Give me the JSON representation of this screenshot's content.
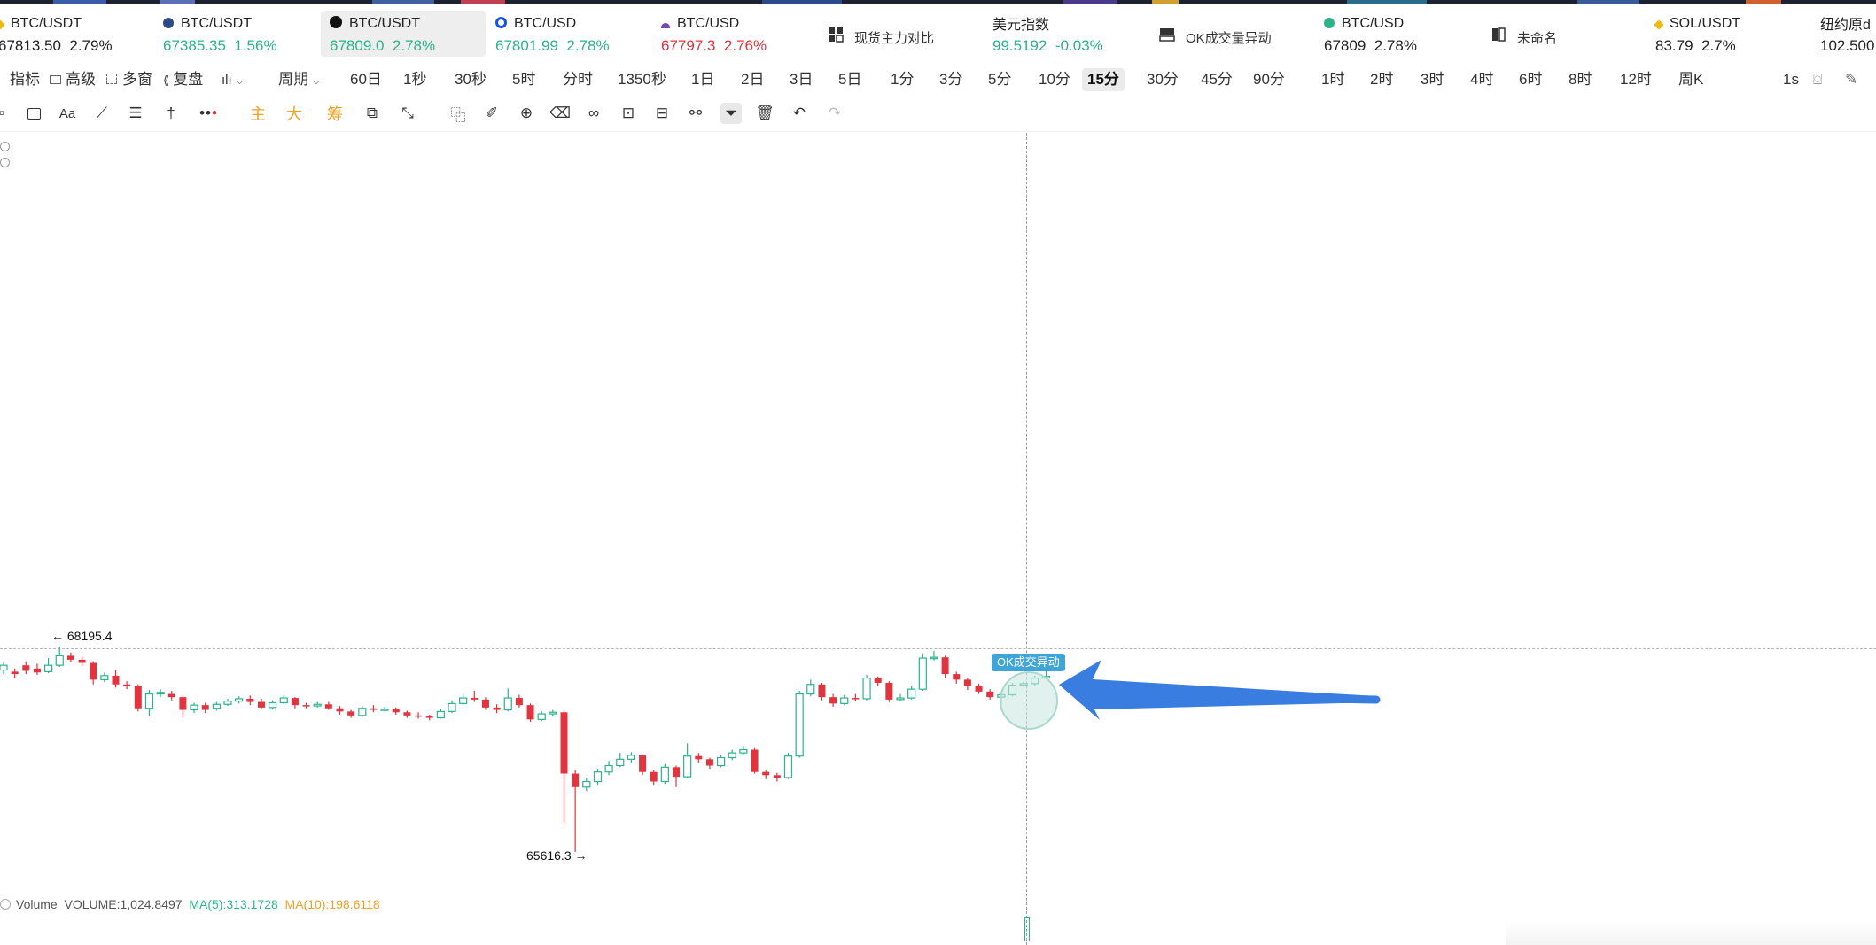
{
  "tickers": [
    {
      "pair": "BTC/USDT",
      "price": "67813.50",
      "change": "2.79%",
      "color": "dark",
      "icon": "binance-icon",
      "icon_color": "#f0b90b",
      "active": false
    },
    {
      "pair": "BTC/USDT",
      "price": "67385.35",
      "change": "1.56%",
      "color": "green",
      "icon": "huobi-icon",
      "icon_color": "#2e4a8a",
      "active": false
    },
    {
      "pair": "BTC/USDT",
      "price": "67809.0",
      "change": "2.78%",
      "color": "green",
      "icon": "okx-icon",
      "icon_color": "#111111",
      "active": true
    },
    {
      "pair": "BTC/USD",
      "price": "67801.99",
      "change": "2.78%",
      "color": "green",
      "icon": "coinbase-icon",
      "icon_color": "#1652f0",
      "active": false
    },
    {
      "pair": "BTC/USD",
      "price": "67797.3",
      "change": "2.76%",
      "color": "red",
      "icon": "kraken-icon",
      "icon_color": "#6f4ab3",
      "active": false
    },
    {
      "label": "现货主力对比",
      "icon": "grid-icon",
      "module": true
    },
    {
      "pair": "美元指数",
      "price": "99.5192",
      "change": "-0.03%",
      "color": "green",
      "icon": "",
      "active": false
    },
    {
      "label": "OK成交量异动",
      "icon": "monitor-icon",
      "module": true
    },
    {
      "pair": "BTC/USD",
      "price": "67809",
      "change": "2.78%",
      "color": "dark",
      "icon": "bitmex-icon",
      "icon_color": "#2bb389",
      "active": false
    },
    {
      "label": "未命名",
      "icon": "split-icon",
      "module": true
    },
    {
      "pair": "SOL/USDT",
      "price": "83.79",
      "change": "2.7%",
      "color": "dark",
      "icon": "binance-icon",
      "icon_color": "#f0b90b",
      "active": false
    },
    {
      "pair": "纽约原d",
      "price": "102.500",
      "change": "",
      "color": "dark",
      "icon": "",
      "active": false
    }
  ],
  "toolbar": {
    "indicator": "指标",
    "advanced": "高级",
    "multi_window": "多窗",
    "replay": "复盘",
    "period": "周期",
    "periods": [
      "60日",
      "1秒",
      "30秒",
      "5时",
      "分时",
      "1350秒",
      "1日",
      "2日",
      "3日",
      "5日",
      "1分",
      "3分",
      "5分",
      "10分",
      "15分",
      "30分",
      "45分",
      "90分",
      "1时",
      "2时",
      "3时",
      "4时",
      "6时",
      "8时",
      "12时",
      "周K"
    ],
    "active_period": "15分",
    "right_interval": "1s"
  },
  "drawing_tools": {
    "text_tool": "Aa",
    "main": "主",
    "big": "大",
    "chips": "筹"
  },
  "chart": {
    "high_label": "← 68195.4",
    "low_label": "65616.3 →",
    "alert_tag": "OK成交异动",
    "colors": {
      "up": "#2bb389",
      "down": "#e0343f",
      "arrow": "#3a7de0"
    }
  },
  "chart_data": {
    "type": "candlestick",
    "title": "BTC/USDT",
    "interval": "15分",
    "high": 68195.4,
    "low": 65616.3,
    "candles": [
      {
        "o": 67900,
        "c": 67960,
        "h": 68000,
        "l": 67850
      },
      {
        "o": 67880,
        "c": 67850,
        "h": 67920,
        "l": 67800
      },
      {
        "o": 67960,
        "c": 67890,
        "h": 68010,
        "l": 67850
      },
      {
        "o": 67920,
        "c": 67870,
        "h": 67980,
        "l": 67840
      },
      {
        "o": 67880,
        "c": 67960,
        "h": 68050,
        "l": 67860
      },
      {
        "o": 67960,
        "c": 68080,
        "h": 68195.4,
        "l": 67940
      },
      {
        "o": 68080,
        "c": 68030,
        "h": 68120,
        "l": 68000
      },
      {
        "o": 68030,
        "c": 67990,
        "h": 68070,
        "l": 67950
      },
      {
        "o": 67990,
        "c": 67780,
        "h": 68010,
        "l": 67720
      },
      {
        "o": 67780,
        "c": 67830,
        "h": 67870,
        "l": 67750
      },
      {
        "o": 67830,
        "c": 67720,
        "h": 67900,
        "l": 67680
      },
      {
        "o": 67720,
        "c": 67700,
        "h": 67760,
        "l": 67660
      },
      {
        "o": 67700,
        "c": 67420,
        "h": 67720,
        "l": 67380
      },
      {
        "o": 67420,
        "c": 67600,
        "h": 67650,
        "l": 67320
      },
      {
        "o": 67600,
        "c": 67620,
        "h": 67660,
        "l": 67560
      },
      {
        "o": 67600,
        "c": 67560,
        "h": 67640,
        "l": 67520
      },
      {
        "o": 67560,
        "c": 67400,
        "h": 67580,
        "l": 67300
      },
      {
        "o": 67400,
        "c": 67460,
        "h": 67490,
        "l": 67360
      },
      {
        "o": 67460,
        "c": 67400,
        "h": 67490,
        "l": 67360
      },
      {
        "o": 67420,
        "c": 67470,
        "h": 67500,
        "l": 67390
      },
      {
        "o": 67470,
        "c": 67510,
        "h": 67540,
        "l": 67450
      },
      {
        "o": 67510,
        "c": 67540,
        "h": 67570,
        "l": 67480
      },
      {
        "o": 67540,
        "c": 67500,
        "h": 67580,
        "l": 67460
      },
      {
        "o": 67500,
        "c": 67430,
        "h": 67540,
        "l": 67410
      },
      {
        "o": 67430,
        "c": 67490,
        "h": 67520,
        "l": 67410
      },
      {
        "o": 67490,
        "c": 67550,
        "h": 67580,
        "l": 67470
      },
      {
        "o": 67550,
        "c": 67460,
        "h": 67560,
        "l": 67420
      },
      {
        "o": 67460,
        "c": 67450,
        "h": 67490,
        "l": 67420
      },
      {
        "o": 67450,
        "c": 67470,
        "h": 67500,
        "l": 67430
      },
      {
        "o": 67470,
        "c": 67420,
        "h": 67500,
        "l": 67400
      },
      {
        "o": 67420,
        "c": 67380,
        "h": 67450,
        "l": 67340
      },
      {
        "o": 67380,
        "c": 67330,
        "h": 67400,
        "l": 67300
      },
      {
        "o": 67330,
        "c": 67420,
        "h": 67450,
        "l": 67310
      },
      {
        "o": 67420,
        "c": 67400,
        "h": 67460,
        "l": 67370
      },
      {
        "o": 67400,
        "c": 67410,
        "h": 67440,
        "l": 67380
      },
      {
        "o": 67410,
        "c": 67370,
        "h": 67430,
        "l": 67340
      },
      {
        "o": 67370,
        "c": 67330,
        "h": 67390,
        "l": 67300
      },
      {
        "o": 67330,
        "c": 67320,
        "h": 67370,
        "l": 67290
      },
      {
        "o": 67320,
        "c": 67300,
        "h": 67340,
        "l": 67270
      },
      {
        "o": 67300,
        "c": 67380,
        "h": 67410,
        "l": 67290
      },
      {
        "o": 67380,
        "c": 67480,
        "h": 67520,
        "l": 67360
      },
      {
        "o": 67480,
        "c": 67550,
        "h": 67600,
        "l": 67460
      },
      {
        "o": 67550,
        "c": 67530,
        "h": 67640,
        "l": 67500
      },
      {
        "o": 67530,
        "c": 67430,
        "h": 67560,
        "l": 67400
      },
      {
        "o": 67430,
        "c": 67400,
        "h": 67470,
        "l": 67360
      },
      {
        "o": 67400,
        "c": 67550,
        "h": 67670,
        "l": 67380
      },
      {
        "o": 67550,
        "c": 67460,
        "h": 67590,
        "l": 67430
      },
      {
        "o": 67460,
        "c": 67280,
        "h": 67480,
        "l": 67250
      },
      {
        "o": 67280,
        "c": 67350,
        "h": 67380,
        "l": 67260
      },
      {
        "o": 67350,
        "c": 67370,
        "h": 67400,
        "l": 67320
      },
      {
        "o": 67370,
        "c": 66600,
        "h": 67390,
        "l": 65980
      },
      {
        "o": 66600,
        "c": 66430,
        "h": 66650,
        "l": 65616.3
      },
      {
        "o": 66430,
        "c": 66500,
        "h": 66550,
        "l": 66380
      },
      {
        "o": 66500,
        "c": 66620,
        "h": 66660,
        "l": 66460
      },
      {
        "o": 66620,
        "c": 66700,
        "h": 66760,
        "l": 66580
      },
      {
        "o": 66700,
        "c": 66780,
        "h": 66860,
        "l": 66680
      },
      {
        "o": 66780,
        "c": 66830,
        "h": 66870,
        "l": 66740
      },
      {
        "o": 66830,
        "c": 66620,
        "h": 66840,
        "l": 66580
      },
      {
        "o": 66620,
        "c": 66500,
        "h": 66650,
        "l": 66460
      },
      {
        "o": 66500,
        "c": 66680,
        "h": 66720,
        "l": 66470
      },
      {
        "o": 66680,
        "c": 66560,
        "h": 66700,
        "l": 66430
      },
      {
        "o": 66560,
        "c": 66820,
        "h": 66980,
        "l": 66540
      },
      {
        "o": 66820,
        "c": 66780,
        "h": 66860,
        "l": 66740
      },
      {
        "o": 66780,
        "c": 66700,
        "h": 66800,
        "l": 66660
      },
      {
        "o": 66700,
        "c": 66800,
        "h": 66830,
        "l": 66680
      },
      {
        "o": 66800,
        "c": 66860,
        "h": 66900,
        "l": 66770
      },
      {
        "o": 66860,
        "c": 66900,
        "h": 66950,
        "l": 66840
      },
      {
        "o": 66900,
        "c": 66620,
        "h": 66920,
        "l": 66600
      },
      {
        "o": 66620,
        "c": 66580,
        "h": 66650,
        "l": 66530
      },
      {
        "o": 66580,
        "c": 66550,
        "h": 66610,
        "l": 66500
      },
      {
        "o": 66550,
        "c": 66820,
        "h": 66860,
        "l": 66530
      },
      {
        "o": 66820,
        "c": 67600,
        "h": 67640,
        "l": 66800
      },
      {
        "o": 67600,
        "c": 67720,
        "h": 67780,
        "l": 67570
      },
      {
        "o": 67720,
        "c": 67560,
        "h": 67740,
        "l": 67520
      },
      {
        "o": 67560,
        "c": 67480,
        "h": 67600,
        "l": 67440
      },
      {
        "o": 67480,
        "c": 67550,
        "h": 67590,
        "l": 67460
      },
      {
        "o": 67550,
        "c": 67540,
        "h": 67600,
        "l": 67510
      },
      {
        "o": 67540,
        "c": 67800,
        "h": 67840,
        "l": 67520
      },
      {
        "o": 67800,
        "c": 67740,
        "h": 67820,
        "l": 67700
      },
      {
        "o": 67740,
        "c": 67530,
        "h": 67760,
        "l": 67500
      },
      {
        "o": 67530,
        "c": 67550,
        "h": 67600,
        "l": 67510
      },
      {
        "o": 67550,
        "c": 67660,
        "h": 67700,
        "l": 67530
      },
      {
        "o": 67660,
        "c": 68050,
        "h": 68110,
        "l": 67640
      },
      {
        "o": 68050,
        "c": 68060,
        "h": 68140,
        "l": 68020
      },
      {
        "o": 68060,
        "c": 67850,
        "h": 68080,
        "l": 67800
      },
      {
        "o": 67850,
        "c": 67780,
        "h": 67880,
        "l": 67730
      },
      {
        "o": 67780,
        "c": 67700,
        "h": 67800,
        "l": 67650
      },
      {
        "o": 67700,
        "c": 67630,
        "h": 67730,
        "l": 67600
      },
      {
        "o": 67630,
        "c": 67560,
        "h": 67660,
        "l": 67530
      },
      {
        "o": 67560,
        "c": 67590,
        "h": 67620,
        "l": 67400
      },
      {
        "o": 67590,
        "c": 67710,
        "h": 67740,
        "l": 67570
      },
      {
        "o": 67710,
        "c": 67730,
        "h": 67760,
        "l": 67690
      },
      {
        "o": 67730,
        "c": 67800,
        "h": 67830,
        "l": 67700
      },
      {
        "o": 67800,
        "c": 67820,
        "h": 67960,
        "l": 67790
      }
    ],
    "volume": {
      "label": "Volume",
      "value": "VOLUME:1,024.8497",
      "ma5": "MA(5):313.1728",
      "ma10": "MA(10):198.6118"
    }
  }
}
